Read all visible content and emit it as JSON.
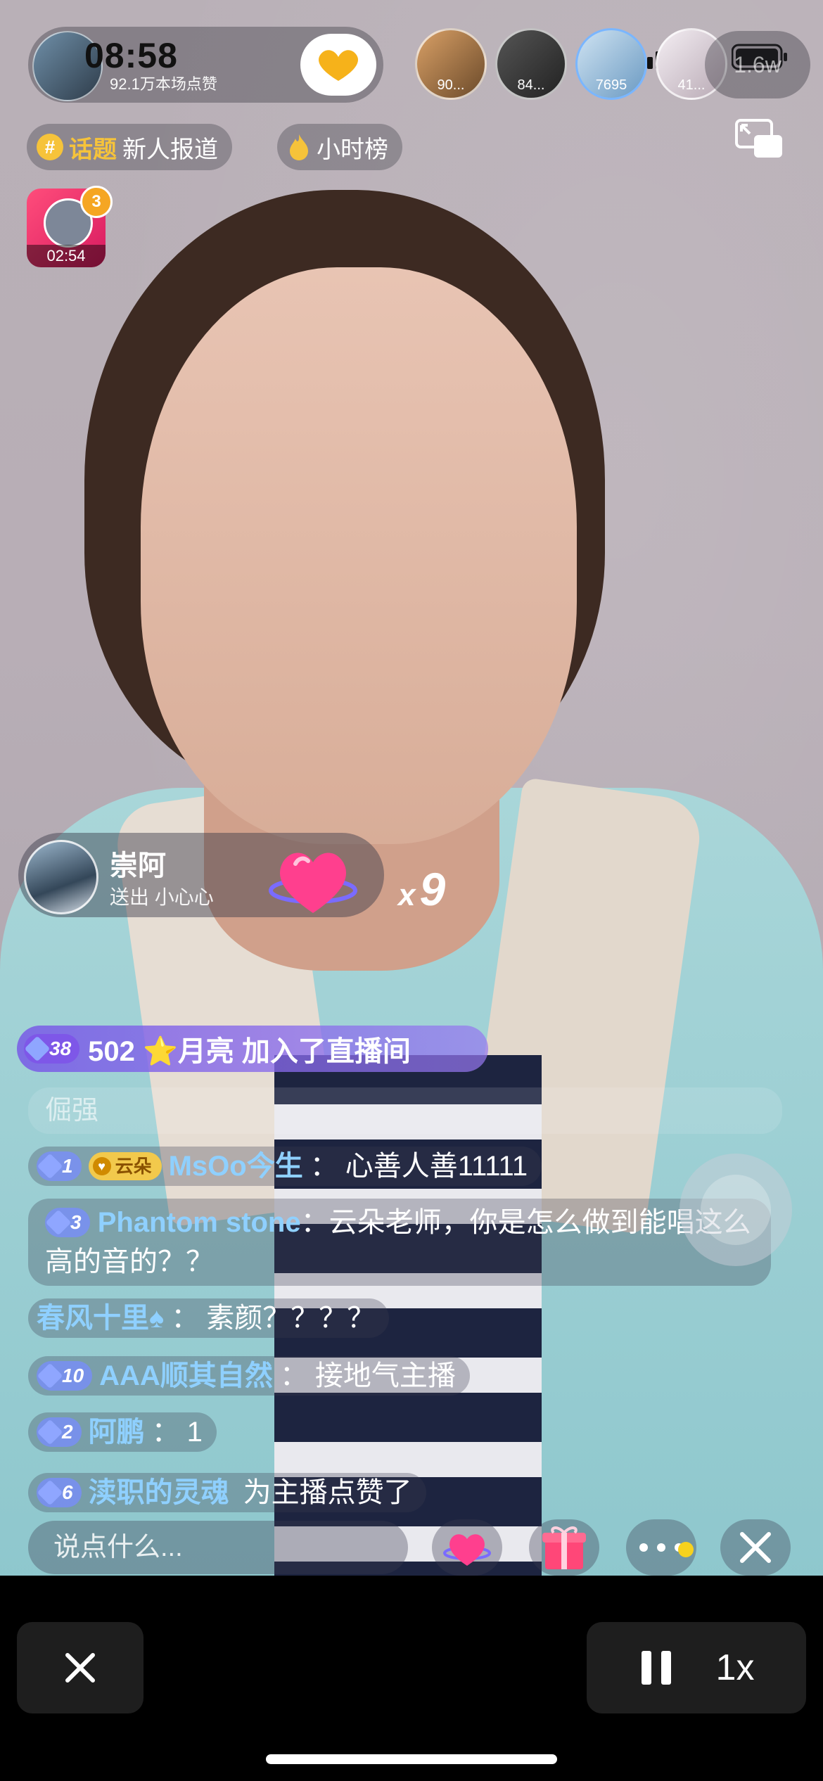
{
  "status_bar": {
    "time": "08:58"
  },
  "host": {
    "likes_text": "92.1万本场点赞"
  },
  "viewers": [
    {
      "count": "90...",
      "color": "#c98a4a"
    },
    {
      "count": "84...",
      "color": "#3a3a3a"
    },
    {
      "count": "7695",
      "color": "#8bb7d9"
    },
    {
      "count": "41...",
      "color": "#e9e2e8"
    }
  ],
  "viewer_total": "1.6w",
  "tags": {
    "topic_label": "话题",
    "topic_value": "新人报道",
    "rank_label": "小时榜"
  },
  "mini_card": {
    "badge": "3",
    "time": "02:54"
  },
  "gift": {
    "sender": "崇阿",
    "action": "送出 小心心",
    "count_x": "x",
    "count": "9"
  },
  "chat": {
    "entry": {
      "level": "38",
      "text": "502 ⭐月亮 加入了直播间"
    },
    "faint_text": "倔强",
    "messages": [
      {
        "level": "1",
        "fan_badge": "云朵",
        "name": "MsOo今生",
        "sep": "：",
        "text": "心善人善11111"
      },
      {
        "level": "3",
        "name": "Phantom stone",
        "sep": "：",
        "text": "云朵老师，你是怎么做到能唱这么高的音的？？"
      },
      {
        "name": "春风十里♠",
        "sep": "：",
        "text": "素颜？？？？"
      },
      {
        "level": "10",
        "name": "AAA顺其自然",
        "sep": "：",
        "text": "接地气主播"
      },
      {
        "level": "2",
        "name": "阿鹏",
        "sep": "：",
        "text": "1"
      },
      {
        "level": "6",
        "name": "渎职的灵魂",
        "sep": " ",
        "text": "为主播点赞了"
      }
    ]
  },
  "input": {
    "placeholder": "说点什么..."
  },
  "player": {
    "speed": "1x"
  },
  "colors": {
    "accent_yellow": "#f6c33a",
    "chat_name": "#8fd0ff",
    "entry_purple": "#7e57e8"
  }
}
